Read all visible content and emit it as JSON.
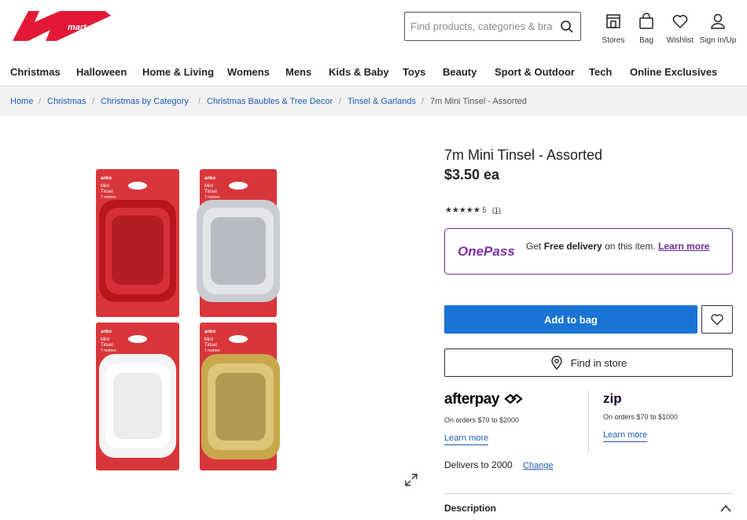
{
  "header": {
    "logo_text": "mart",
    "search_placeholder": "Find products, categories & brands",
    "icons": [
      {
        "label": "Stores",
        "icon": "store-icon"
      },
      {
        "label": "Bag",
        "icon": "bag-icon"
      },
      {
        "label": "Wishlist",
        "icon": "heart-icon"
      },
      {
        "label": "Sign In/Up",
        "icon": "user-icon"
      }
    ]
  },
  "nav": [
    "Christmas",
    "Halloween",
    "Home & Living",
    "Womens",
    "Mens",
    "Kids & Baby",
    "Toys",
    "Beauty",
    "Sport & Outdoor",
    "Tech",
    "Online Exclusives"
  ],
  "breadcrumb": [
    "Home",
    "Christmas",
    "Christmas by Category",
    "Christmas Baubles & Tree Decor",
    "Tinsel & Garlands",
    "7m Mini Tinsel - Assorted"
  ],
  "product": {
    "title": "7m Mini Tinsel - Assorted",
    "price": "$3.50 ea",
    "stars": "★★★★★",
    "rating": "5",
    "review_count": "(1)",
    "pack_brand": "anko",
    "pack_text": [
      "Mini",
      "Tinsel",
      "7 metres"
    ],
    "colors": {
      "red": "#c8262b",
      "silver": "#c9ccd2",
      "white": "#f4f4f4",
      "gold": "#c9a84c"
    }
  },
  "onepass": {
    "logo": "OnePass",
    "text_pre": "Get ",
    "text_bold": "Free delivery",
    "text_post": " on this item.  ",
    "link": "Learn more"
  },
  "buttons": {
    "add_to_bag": "Add to bag",
    "find_in_store": "Find in store"
  },
  "afterpay": {
    "logo": "afterpay",
    "terms": "On orders $70 to $2000",
    "link": "Learn more"
  },
  "zip": {
    "logo": "zip",
    "terms": "On orders $70 to $1000",
    "link": "Learn more"
  },
  "delivery": {
    "text": "Delivers to 2000",
    "change": "Change"
  },
  "description": {
    "label": "Description"
  },
  "accent": "#1a74d3"
}
